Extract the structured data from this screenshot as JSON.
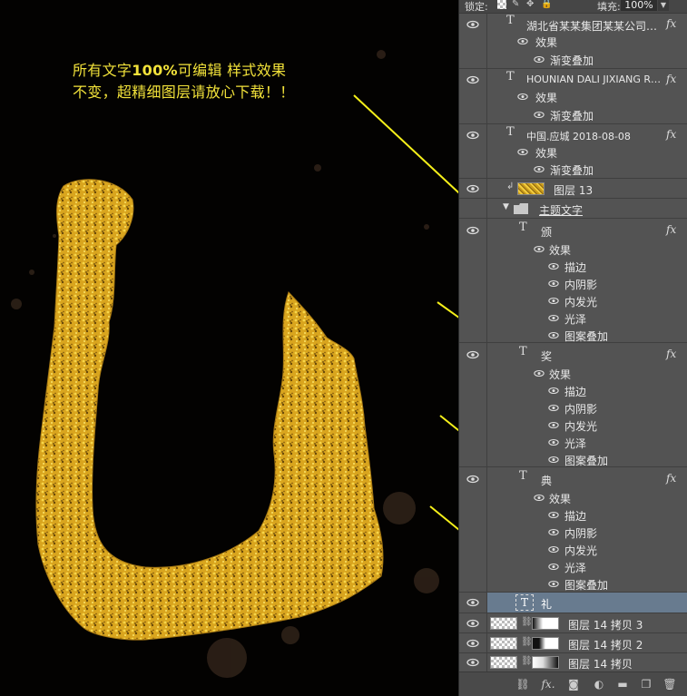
{
  "canvas": {
    "note_line1_a": "所有文字",
    "note_line1_b": "100%",
    "note_line1_c": "可编辑 样式效果",
    "note_line2": "不变，超精细图层请放心下载！！"
  },
  "toolbar": {
    "lock_label": "锁定:",
    "fill_label": "填充:",
    "fill_value": "100%"
  },
  "layers": {
    "l1_name": "湖北省某某集团某某公司…",
    "l1_effects": "效果",
    "l1_effect_1": "渐变叠加",
    "l2_name": "HOUNIAN DALI JIXIANG R…",
    "l2_effects": "效果",
    "l2_effect_1": "渐变叠加",
    "l3_name": "中国.应城 2018-08-08",
    "l3_effects": "效果",
    "l3_effect_1": "渐变叠加",
    "l4_name": "图层 13",
    "group_name": "主题文字",
    "l5_name": "颁",
    "l5_effects": "效果",
    "l5_e1": "描边",
    "l5_e2": "内阴影",
    "l5_e3": "内发光",
    "l5_e4": "光泽",
    "l5_e5": "图案叠加",
    "l6_name": "奖",
    "l6_effects": "效果",
    "l6_e1": "描边",
    "l6_e2": "内阴影",
    "l6_e3": "内发光",
    "l6_e4": "光泽",
    "l6_e5": "图案叠加",
    "l7_name": "典",
    "l7_effects": "效果",
    "l7_e1": "描边",
    "l7_e2": "内阴影",
    "l7_e3": "内发光",
    "l7_e4": "光泽",
    "l7_e5": "图案叠加",
    "l8_name": "礼",
    "l9_name": "图层 14 拷贝 3",
    "l10_name": "图层 14 拷贝 2",
    "l11_name": "图层 14 拷贝",
    "fx_label": "fx"
  },
  "colors": {
    "accent_yellow": "#f2e23a",
    "gold": "#e8b828",
    "panel_bg": "#535353",
    "selected_row": "#687b8f"
  }
}
